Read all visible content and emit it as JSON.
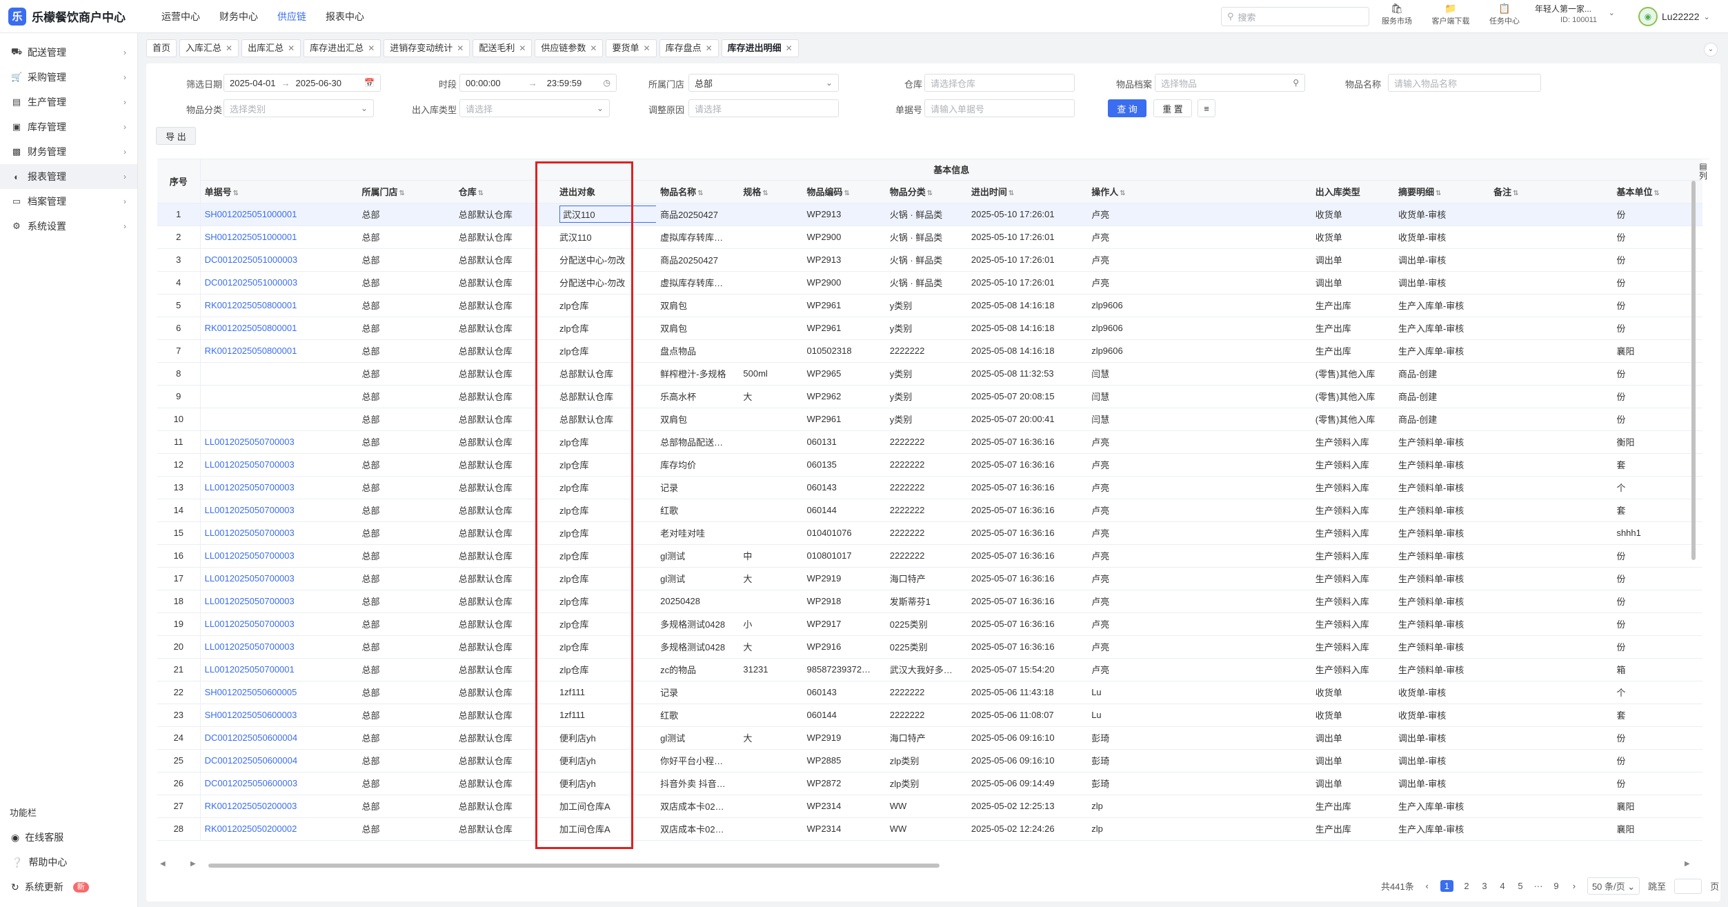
{
  "app": {
    "title": "乐檬餐饮商户中心",
    "logo_char": "乐"
  },
  "topnav": [
    "运营中心",
    "财务中心",
    "供应链",
    "报表中心"
  ],
  "topnav_active": 2,
  "search": {
    "placeholder": "搜索"
  },
  "topicons": [
    {
      "label": "服务市场",
      "icon": "market-icon"
    },
    {
      "label": "客户端下载",
      "icon": "folder-icon"
    },
    {
      "label": "任务中心",
      "icon": "task-icon"
    }
  ],
  "store": {
    "name": "年轻人第一家...",
    "id": "ID: 100011"
  },
  "user": {
    "name": "Lu22222"
  },
  "sidebar": {
    "items": [
      {
        "label": "配送管理",
        "icon": "truck-icon"
      },
      {
        "label": "采购管理",
        "icon": "cart-icon"
      },
      {
        "label": "生产管理",
        "icon": "chart-icon"
      },
      {
        "label": "库存管理",
        "icon": "lock-icon"
      },
      {
        "label": "财务管理",
        "icon": "wallet-icon"
      },
      {
        "label": "报表管理",
        "icon": "report-icon"
      },
      {
        "label": "档案管理",
        "icon": "archive-icon"
      },
      {
        "label": "系统设置",
        "icon": "gear-icon"
      }
    ],
    "active_index": 5,
    "func_title": "功能栏",
    "func_items": [
      {
        "label": "在线客服",
        "icon": "service-icon"
      },
      {
        "label": "帮助中心",
        "icon": "help-icon"
      },
      {
        "label": "系统更新",
        "icon": "refresh-icon",
        "badge": "新"
      }
    ]
  },
  "tabs": [
    "首页",
    "入库汇总",
    "出库汇总",
    "库存进出汇总",
    "进销存变动统计",
    "配送毛利",
    "供应链参数",
    "要货单",
    "库存盘点",
    "库存进出明细"
  ],
  "tabs_active": 9,
  "filters": {
    "date_label": "筛选日期",
    "date_start": "2025-04-01",
    "date_end": "2025-06-30",
    "time_label": "时段",
    "time_start": "00:00:00",
    "time_end": "23:59:59",
    "store_label": "所属门店",
    "store_value": "总部",
    "warehouse_label": "仓库",
    "warehouse_placeholder": "请选择仓库",
    "archive_label": "物品档案",
    "archive_placeholder": "选择物品",
    "itemname_label": "物品名称",
    "itemname_placeholder": "请输入物品名称",
    "category_label": "物品分类",
    "category_placeholder": "选择类别",
    "io_type_label": "出入库类型",
    "io_type_placeholder": "请选择",
    "reason_label": "调整原因",
    "reason_placeholder": "请选择",
    "docno_label": "单据号",
    "docno_placeholder": "请输入单据号",
    "query_btn": "查 询",
    "reset_btn": "重 置",
    "export_btn": "导 出"
  },
  "table": {
    "group_header": "基本信息",
    "col_set": "列",
    "columns": [
      "序号",
      "单据号",
      "所属门店",
      "仓库",
      "进出对象",
      "物品名称",
      "规格",
      "物品编码",
      "物品分类",
      "进出时间",
      "操作人",
      "出入库类型",
      "摘要明细",
      "备注",
      "基本单位"
    ],
    "rows": [
      [
        "1",
        "SH0012025051000001",
        "总部",
        "总部默认仓库",
        "武汉110",
        "商品20250427",
        "",
        "WP2913",
        "火锅 · 鲜品类",
        "2025-05-10 17:26:01",
        "卢亮",
        "收货单",
        "收货单-审核",
        "",
        "份"
      ],
      [
        "2",
        "SH0012025051000001",
        "总部",
        "总部默认仓库",
        "武汉110",
        "虚拟库存转库…",
        "",
        "WP2900",
        "火锅 · 鲜品类",
        "2025-05-10 17:26:01",
        "卢亮",
        "收货单",
        "收货单-审核",
        "",
        "份"
      ],
      [
        "3",
        "DC0012025051000003",
        "总部",
        "总部默认仓库",
        "分配送中心-勿改",
        "商品20250427",
        "",
        "WP2913",
        "火锅 · 鲜品类",
        "2025-05-10 17:26:01",
        "卢亮",
        "调出单",
        "调出单-审核",
        "",
        "份"
      ],
      [
        "4",
        "DC0012025051000003",
        "总部",
        "总部默认仓库",
        "分配送中心-勿改",
        "虚拟库存转库…",
        "",
        "WP2900",
        "火锅 · 鲜品类",
        "2025-05-10 17:26:01",
        "卢亮",
        "调出单",
        "调出单-审核",
        "",
        "份"
      ],
      [
        "5",
        "RK0012025050800001",
        "总部",
        "总部默认仓库",
        "zlp仓库",
        "双肩包",
        "",
        "WP2961",
        "y类别",
        "2025-05-08 14:16:18",
        "zlp9606",
        "生产出库",
        "生产入库单-审核",
        "",
        "份"
      ],
      [
        "6",
        "RK0012025050800001",
        "总部",
        "总部默认仓库",
        "zlp仓库",
        "双肩包",
        "",
        "WP2961",
        "y类别",
        "2025-05-08 14:16:18",
        "zlp9606",
        "生产出库",
        "生产入库单-审核",
        "",
        "份"
      ],
      [
        "7",
        "RK0012025050800001",
        "总部",
        "总部默认仓库",
        "zlp仓库",
        "盘点物品",
        "",
        "010502318",
        "2222222",
        "2025-05-08 14:16:18",
        "zlp9606",
        "生产出库",
        "生产入库单-审核",
        "",
        "襄阳"
      ],
      [
        "8",
        "",
        "总部",
        "总部默认仓库",
        "总部默认仓库",
        "鲜榨橙汁-多规格",
        "500ml",
        "WP2965",
        "y类别",
        "2025-05-08 11:32:53",
        "闫慧",
        "(零售)其他入库",
        "商品-创建",
        "",
        "份"
      ],
      [
        "9",
        "",
        "总部",
        "总部默认仓库",
        "总部默认仓库",
        "乐高水杯",
        "大",
        "WP2962",
        "y类别",
        "2025-05-07 20:08:15",
        "闫慧",
        "(零售)其他入库",
        "商品-创建",
        "",
        "份"
      ],
      [
        "10",
        "",
        "总部",
        "总部默认仓库",
        "总部默认仓库",
        "双肩包",
        "",
        "WP2961",
        "y类别",
        "2025-05-07 20:00:41",
        "闫慧",
        "(零售)其他入库",
        "商品-创建",
        "",
        "份"
      ],
      [
        "11",
        "LL0012025050700003",
        "总部",
        "总部默认仓库",
        "zlp仓库",
        "总部物品配送…",
        "",
        "060131",
        "2222222",
        "2025-05-07 16:36:16",
        "卢亮",
        "生产领料入库",
        "生产领料单-审核",
        "",
        "衡阳"
      ],
      [
        "12",
        "LL0012025050700003",
        "总部",
        "总部默认仓库",
        "zlp仓库",
        "库存均价",
        "",
        "060135",
        "2222222",
        "2025-05-07 16:36:16",
        "卢亮",
        "生产领料入库",
        "生产领料单-审核",
        "",
        "套"
      ],
      [
        "13",
        "LL0012025050700003",
        "总部",
        "总部默认仓库",
        "zlp仓库",
        "记录",
        "",
        "060143",
        "2222222",
        "2025-05-07 16:36:16",
        "卢亮",
        "生产领料入库",
        "生产领料单-审核",
        "",
        "个"
      ],
      [
        "14",
        "LL0012025050700003",
        "总部",
        "总部默认仓库",
        "zlp仓库",
        "红歌",
        "",
        "060144",
        "2222222",
        "2025-05-07 16:36:16",
        "卢亮",
        "生产领料入库",
        "生产领料单-审核",
        "",
        "套"
      ],
      [
        "15",
        "LL0012025050700003",
        "总部",
        "总部默认仓库",
        "zlp仓库",
        "老对哇对哇",
        "",
        "010401076",
        "2222222",
        "2025-05-07 16:36:16",
        "卢亮",
        "生产领料入库",
        "生产领料单-审核",
        "",
        "shhh1"
      ],
      [
        "16",
        "LL0012025050700003",
        "总部",
        "总部默认仓库",
        "zlp仓库",
        "gl测试",
        "中",
        "010801017",
        "2222222",
        "2025-05-07 16:36:16",
        "卢亮",
        "生产领料入库",
        "生产领料单-审核",
        "",
        "份"
      ],
      [
        "17",
        "LL0012025050700003",
        "总部",
        "总部默认仓库",
        "zlp仓库",
        "gl测试",
        "大",
        "WP2919",
        "海口特产",
        "2025-05-07 16:36:16",
        "卢亮",
        "生产领料入库",
        "生产领料单-审核",
        "",
        "份"
      ],
      [
        "18",
        "LL0012025050700003",
        "总部",
        "总部默认仓库",
        "zlp仓库",
        "20250428",
        "",
        "WP2918",
        "发斯蒂芬1",
        "2025-05-07 16:36:16",
        "卢亮",
        "生产领料入库",
        "生产领料单-审核",
        "",
        "份"
      ],
      [
        "19",
        "LL0012025050700003",
        "总部",
        "总部默认仓库",
        "zlp仓库",
        "多规格测试0428",
        "小",
        "WP2917",
        "0225类别",
        "2025-05-07 16:36:16",
        "卢亮",
        "生产领料入库",
        "生产领料单-审核",
        "",
        "份"
      ],
      [
        "20",
        "LL0012025050700003",
        "总部",
        "总部默认仓库",
        "zlp仓库",
        "多规格测试0428",
        "大",
        "WP2916",
        "0225类别",
        "2025-05-07 16:36:16",
        "卢亮",
        "生产领料入库",
        "生产领料单-审核",
        "",
        "份"
      ],
      [
        "21",
        "LL0012025050700001",
        "总部",
        "总部默认仓库",
        "zlp仓库",
        "zc的物品",
        "31231",
        "98587239372…",
        "武汉大我好多…",
        "2025-05-07 15:54:20",
        "卢亮",
        "生产领料入库",
        "生产领料单-审核",
        "",
        "箱"
      ],
      [
        "22",
        "SH0012025050600005",
        "总部",
        "总部默认仓库",
        "1zf111",
        "记录",
        "",
        "060143",
        "2222222",
        "2025-05-06 11:43:18",
        "Lu",
        "收货单",
        "收货单-审核",
        "",
        "个"
      ],
      [
        "23",
        "SH0012025050600003",
        "总部",
        "总部默认仓库",
        "1zf111",
        "红歌",
        "",
        "060144",
        "2222222",
        "2025-05-06 11:08:07",
        "Lu",
        "收货单",
        "收货单-审核",
        "",
        "套"
      ],
      [
        "24",
        "DC0012025050600004",
        "总部",
        "总部默认仓库",
        "便利店yh",
        "gl测试",
        "大",
        "WP2919",
        "海口特产",
        "2025-05-06 09:16:10",
        "彭琦",
        "调出单",
        "调出单-审核",
        "",
        "份"
      ],
      [
        "25",
        "DC0012025050600004",
        "总部",
        "总部默认仓库",
        "便利店yh",
        "你好平台小程…",
        "",
        "WP2885",
        "zlp类别",
        "2025-05-06 09:16:10",
        "彭琦",
        "调出单",
        "调出单-审核",
        "",
        "份"
      ],
      [
        "26",
        "DC0012025050600003",
        "总部",
        "总部默认仓库",
        "便利店yh",
        "抖音外卖 抖音…",
        "",
        "WP2872",
        "zlp类别",
        "2025-05-06 09:14:49",
        "彭琦",
        "调出单",
        "调出单-审核",
        "",
        "份"
      ],
      [
        "27",
        "RK0012025050200003",
        "总部",
        "总部默认仓库",
        "加工间仓库A",
        "双店成本卡02…",
        "",
        "WP2314",
        "WW",
        "2025-05-02 12:25:13",
        "zlp",
        "生产出库",
        "生产入库单-审核",
        "",
        "襄阳"
      ],
      [
        "28",
        "RK0012025050200002",
        "总部",
        "总部默认仓库",
        "加工间仓库A",
        "双店成本卡02…",
        "",
        "WP2314",
        "WW",
        "2025-05-02 12:24:26",
        "zlp",
        "生产出库",
        "生产入库单-审核",
        "",
        "襄阳"
      ]
    ]
  },
  "pager": {
    "total": "共441条",
    "pages": [
      "1",
      "2",
      "3",
      "4",
      "5",
      "···",
      "9"
    ],
    "active_page": "1",
    "page_size": "50 条/页",
    "jump_label": "跳至",
    "page_unit": "页"
  },
  "colors": {
    "accent": "#3a6df0",
    "highlight": "#e02020"
  }
}
